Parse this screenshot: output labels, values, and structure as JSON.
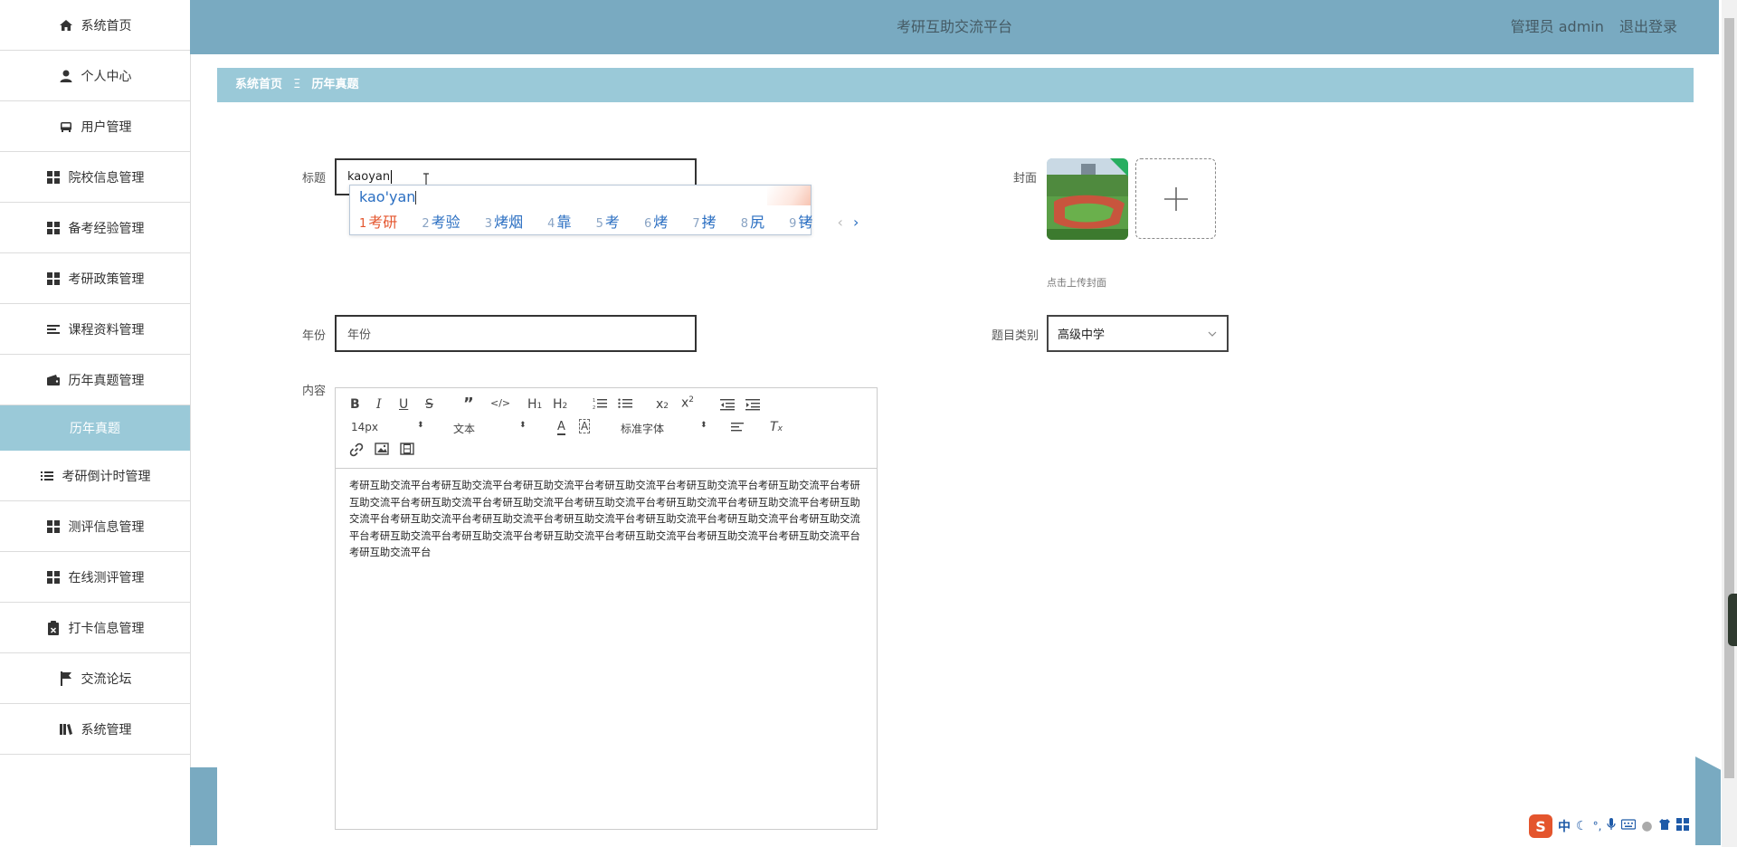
{
  "header": {
    "title": "考研互助交流平台",
    "user_label": "管理员 admin",
    "logout_label": "退出登录"
  },
  "sidebar": {
    "items": [
      {
        "label": "系统首页",
        "icon": "home-icon"
      },
      {
        "label": "个人中心",
        "icon": "user-icon"
      },
      {
        "label": "用户管理",
        "icon": "bus-icon"
      },
      {
        "label": "院校信息管理",
        "icon": "grid-icon"
      },
      {
        "label": "备考经验管理",
        "icon": "grid-icon"
      },
      {
        "label": "考研政策管理",
        "icon": "grid-icon"
      },
      {
        "label": "课程资料管理",
        "icon": "list-icon"
      },
      {
        "label": "历年真题管理",
        "icon": "wallet-icon"
      },
      {
        "label": "历年真题",
        "icon": ""
      },
      {
        "label": "考研倒计时管理",
        "icon": "list-icon"
      },
      {
        "label": "测评信息管理",
        "icon": "grid-icon"
      },
      {
        "label": "在线测评管理",
        "icon": "grid-icon"
      },
      {
        "label": "打卡信息管理",
        "icon": "clipboard-icon"
      },
      {
        "label": "交流论坛",
        "icon": "flag-icon"
      },
      {
        "label": "系统管理",
        "icon": "library-icon"
      }
    ],
    "active_index": 8
  },
  "breadcrumb": {
    "home": "系统首页",
    "separator": "Ξ",
    "current": "历年真题"
  },
  "form": {
    "title_label": "标题",
    "title_value": "kaoyan",
    "cover_label": "封面",
    "cover_hint": "点击上传封面",
    "year_label": "年份",
    "year_placeholder": "年份",
    "category_label": "题目类别",
    "category_value": "高级中学",
    "content_label": "内容"
  },
  "ime": {
    "pinyin": "kao'yan",
    "candidates": [
      {
        "num": "1",
        "text": "考研"
      },
      {
        "num": "2",
        "text": "考验"
      },
      {
        "num": "3",
        "text": "烤烟"
      },
      {
        "num": "4",
        "text": "靠"
      },
      {
        "num": "5",
        "text": "考"
      },
      {
        "num": "6",
        "text": "烤"
      },
      {
        "num": "7",
        "text": "拷"
      },
      {
        "num": "8",
        "text": "尻"
      },
      {
        "num": "9",
        "text": "铐"
      }
    ],
    "prev": "‹",
    "next": "›"
  },
  "editor": {
    "font_size": "14px",
    "block_format": "文本",
    "font_family": "标准字体",
    "content": "考研互助交流平台考研互助交流平台考研互助交流平台考研互助交流平台考研互助交流平台考研互助交流平台考研互助交流平台考研互助交流平台考研互助交流平台考研互助交流平台考研互助交流平台考研互助交流平台考研互助交流平台考研互助交流平台考研互助交流平台考研互助交流平台考研互助交流平台考研互助交流平台考研互助交流平台考研互助交流平台考研互助交流平台考研互助交流平台考研互助交流平台考研互助交流平台考研互助交流平台考研互助交流平台"
  },
  "tray": {
    "lang": "中"
  },
  "colors": {
    "header_bg": "#79aac1",
    "breadcrumb_bg": "#9ac9d8",
    "active_item_bg": "#9ac9d8",
    "ime_first": "#e4552d",
    "ime_text": "#2b6fc2"
  }
}
